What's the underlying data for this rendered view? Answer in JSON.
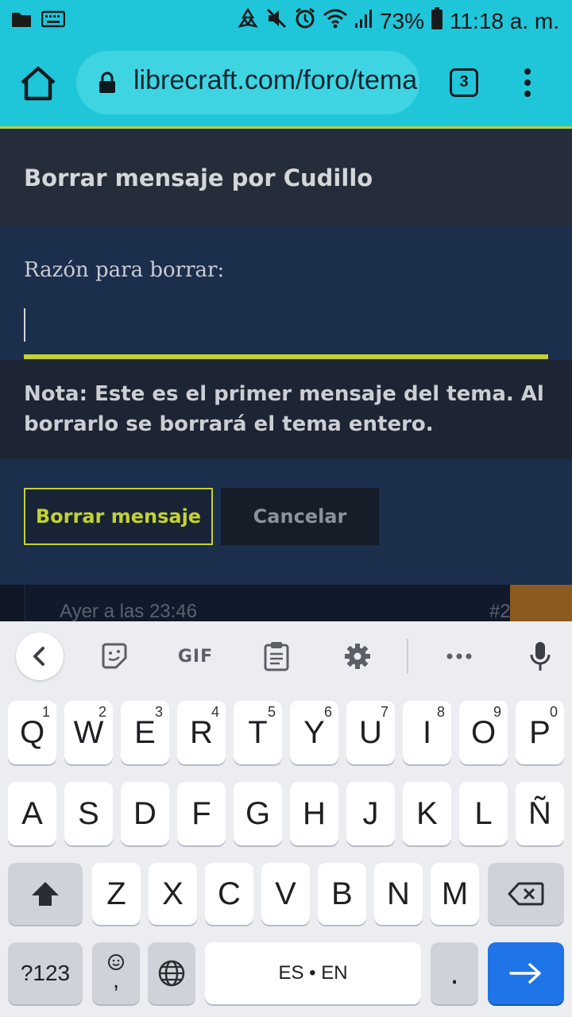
{
  "status_bar": {
    "battery_percent": "73%",
    "time": "11:18 a. m."
  },
  "browser": {
    "url": "librecraft.com/foro/tema",
    "tab_count": "3"
  },
  "dialog": {
    "title": "Borrar mensaje por Cudillo",
    "reason_label": "Razón para borrar:",
    "reason_value": "",
    "note": "Nota: Este es el primer mensaje del tema. Al borrarlo se borrará el tema entero.",
    "delete_button": "Borrar mensaje",
    "cancel_button": "Cancelar"
  },
  "post_preview": {
    "time": "Ayer a las 23:46",
    "number": "#2"
  },
  "keyboard": {
    "toolbar": {
      "gif_label": "GIF"
    },
    "row1": [
      {
        "k": "Q",
        "h": "1"
      },
      {
        "k": "W",
        "h": "2"
      },
      {
        "k": "E",
        "h": "3"
      },
      {
        "k": "R",
        "h": "4"
      },
      {
        "k": "T",
        "h": "5"
      },
      {
        "k": "Y",
        "h": "6"
      },
      {
        "k": "U",
        "h": "7"
      },
      {
        "k": "I",
        "h": "8"
      },
      {
        "k": "O",
        "h": "9"
      },
      {
        "k": "P",
        "h": "0"
      }
    ],
    "row2": [
      "A",
      "S",
      "D",
      "F",
      "G",
      "H",
      "J",
      "K",
      "L",
      "Ñ"
    ],
    "row3": [
      "Z",
      "X",
      "C",
      "V",
      "B",
      "N",
      "M"
    ],
    "symbols_label": "?123",
    "comma_label": ",",
    "space_label": "ES • EN",
    "period_label": "."
  },
  "colors": {
    "chrome_cyan": "#1fc6da",
    "accent_lime": "#c3d232",
    "dialog_bg": "#1b2e4c",
    "enter_blue": "#1f74e8"
  }
}
